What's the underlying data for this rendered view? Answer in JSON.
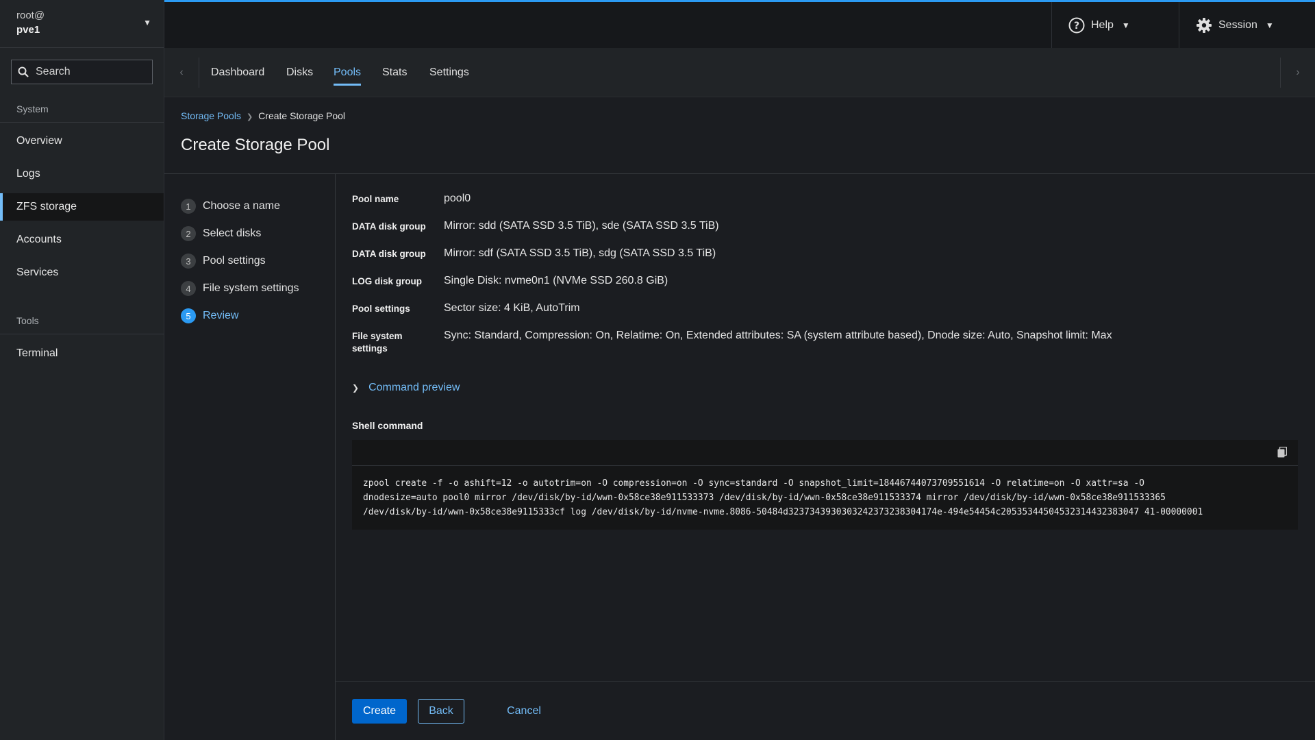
{
  "host": {
    "user": "root@",
    "name": "pve1"
  },
  "search": {
    "placeholder": "Search"
  },
  "sidebar": {
    "system_label": "System",
    "items": [
      {
        "label": "Overview"
      },
      {
        "label": "Logs"
      },
      {
        "label": "ZFS storage",
        "active": true
      },
      {
        "label": "Accounts"
      },
      {
        "label": "Services"
      }
    ],
    "tools_label": "Tools",
    "tools": [
      {
        "label": "Terminal"
      }
    ]
  },
  "header": {
    "help_label": "Help",
    "session_label": "Session"
  },
  "tabs": [
    {
      "label": "Dashboard"
    },
    {
      "label": "Disks"
    },
    {
      "label": "Pools",
      "active": true
    },
    {
      "label": "Stats"
    },
    {
      "label": "Settings"
    }
  ],
  "breadcrumb": {
    "parent": "Storage Pools",
    "current": "Create Storage Pool"
  },
  "page_title": "Create Storage Pool",
  "steps": [
    {
      "num": "1",
      "label": "Choose a name"
    },
    {
      "num": "2",
      "label": "Select disks"
    },
    {
      "num": "3",
      "label": "Pool settings"
    },
    {
      "num": "4",
      "label": "File system settings"
    },
    {
      "num": "5",
      "label": "Review",
      "active": true
    }
  ],
  "review": [
    {
      "term": "Pool name",
      "value": "pool0"
    },
    {
      "term": "DATA disk group",
      "value": "Mirror: sdd (SATA SSD 3.5 TiB), sde (SATA SSD 3.5 TiB)"
    },
    {
      "term": "DATA disk group",
      "value": "Mirror: sdf (SATA SSD 3.5 TiB), sdg (SATA SSD 3.5 TiB)"
    },
    {
      "term": "LOG disk group",
      "value": "Single Disk: nvme0n1 (NVMe SSD 260.8 GiB)"
    },
    {
      "term": "Pool settings",
      "value": "Sector size: 4 KiB, AutoTrim"
    },
    {
      "term": "File system settings",
      "value": "Sync: Standard, Compression: On, Relatime: On, Extended attributes: SA (system attribute based), Dnode size: Auto, Snapshot limit: Max"
    }
  ],
  "command_preview": {
    "toggle_label": "Command preview",
    "shell_label": "Shell command",
    "lines": [
      "zpool create -f -o ashift=12 -o autotrim=on -O compression=on -O sync=standard -O snapshot_limit=18446744073709551614 -O relatime=on -O xattr=sa -O",
      "dnodesize=auto pool0 mirror /dev/disk/by-id/wwn-0x58ce38e911533373 /dev/disk/by-id/wwn-0x58ce38e911533374 mirror /dev/disk/by-id/wwn-0x58ce38e911533365",
      "/dev/disk/by-id/wwn-0x58ce38e9115333cf log /dev/disk/by-id/nvme-nvme.8086-50484d3237343930303242373238304174e-494e54454c20535344504532314432383047 41-00000001"
    ]
  },
  "actions": {
    "create": "Create",
    "back": "Back",
    "cancel": "Cancel"
  },
  "colors": {
    "accent": "#73bcf7",
    "primary": "#0066cc",
    "top_border": "#2b9af3"
  }
}
